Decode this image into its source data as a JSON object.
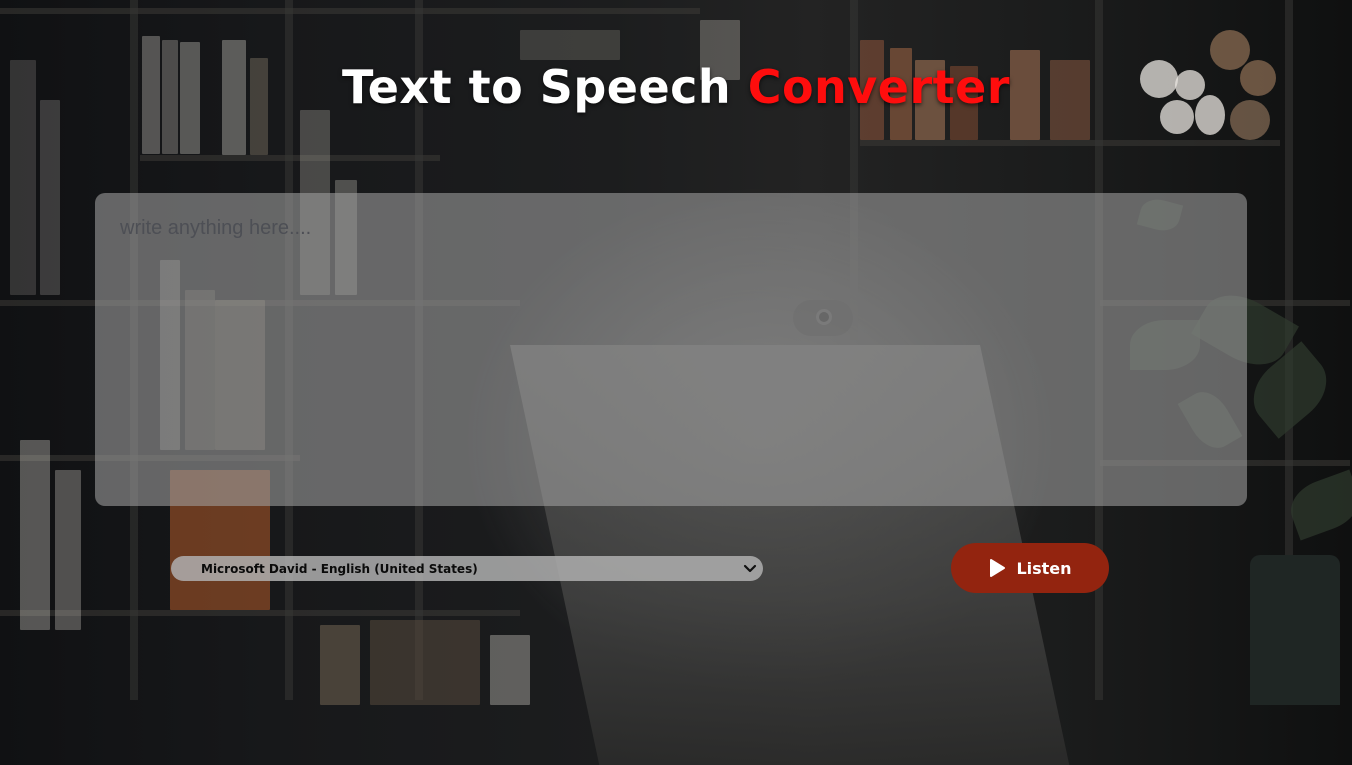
{
  "header": {
    "title_main": "Text to Speech ",
    "title_accent": "Converter"
  },
  "editor": {
    "placeholder": "write anything here....",
    "value": ""
  },
  "voice": {
    "selected": "Microsoft David - English (United States)"
  },
  "listen_button": {
    "label": "Listen",
    "icon": "play-icon"
  },
  "colors": {
    "accent": "#ff0d0d",
    "button": "#93240f",
    "title": "#ffffff"
  }
}
